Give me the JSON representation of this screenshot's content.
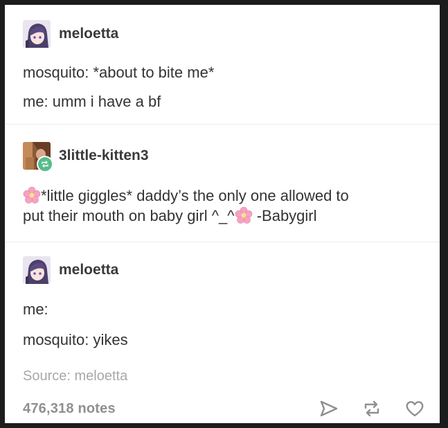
{
  "posts": [
    {
      "username": "meloetta",
      "lines": [
        "mosquito: *about to bite me*",
        "me: umm i have a bf"
      ]
    },
    {
      "username": "3little-kitten3",
      "line1": "*little giggles* daddy’s the only one allowed to",
      "line2_a": "put their mouth on baby girl ^_^",
      "line2_b": " -Babygirl"
    },
    {
      "username": "meloetta",
      "lines": [
        "me:",
        "mosquito: yikes"
      ],
      "source": "Source: meloetta"
    }
  ],
  "footer": {
    "notes": "476,318 notes"
  },
  "icons": {
    "avatar_meloetta": "anime-avatar-icon",
    "avatar_kitten": "photo-avatar-icon",
    "reblog_badge": "reblog-icon",
    "flower": "cherry-blossom-icon",
    "share": "share-icon",
    "reblog": "reblog-icon",
    "like": "heart-icon"
  },
  "colors": {
    "reblog_green": "#56bc8a",
    "flower_pink": "#f5a3c0"
  }
}
